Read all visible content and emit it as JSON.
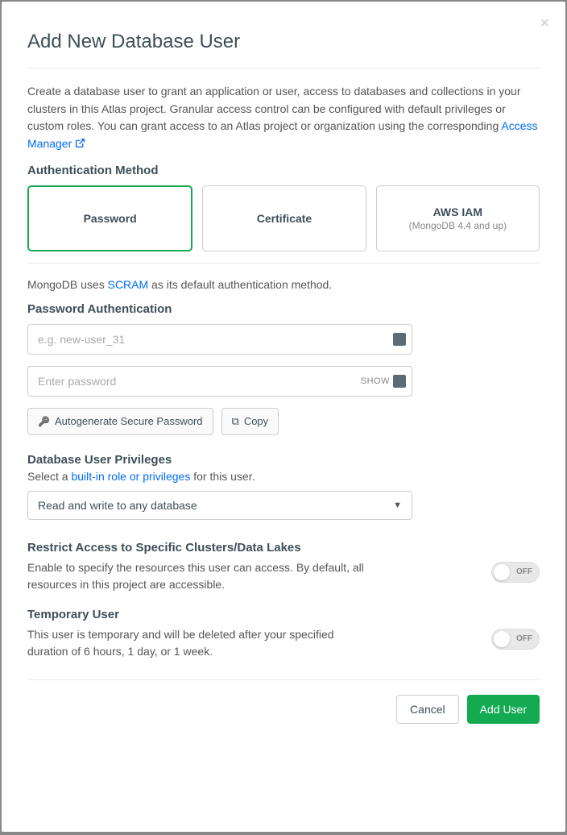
{
  "modal": {
    "title": "Add New Database User",
    "description_pre": "Create a database user to grant an application or user, access to databases and collections in your clusters in this Atlas project. Granular access control can be configured with default privileges or custom roles. You can grant access to an Atlas project or organization using the corresponding ",
    "access_manager_link": "Access Manager"
  },
  "auth": {
    "section_label": "Authentication Method",
    "methods": [
      {
        "label": "Password",
        "sub": ""
      },
      {
        "label": "Certificate",
        "sub": ""
      },
      {
        "label": "AWS IAM",
        "sub": "(MongoDB 4.4 and up)"
      }
    ],
    "selected_index": 0,
    "scram_note_pre": "MongoDB uses ",
    "scram_link": "SCRAM",
    "scram_note_post": " as its default authentication method."
  },
  "password_auth": {
    "section_label": "Password Authentication",
    "username_placeholder": "e.g. new-user_31",
    "username_value": "",
    "password_placeholder": "Enter password",
    "password_value": "",
    "show_label": "SHOW",
    "autogen_label": "Autogenerate Secure Password",
    "copy_label": "Copy"
  },
  "privileges": {
    "section_label": "Database User Privileges",
    "helper_pre": "Select a ",
    "helper_link": "built-in role or privileges",
    "helper_post": " for this user.",
    "selected": "Read and write to any database"
  },
  "restrict": {
    "section_label": "Restrict Access to Specific Clusters/Data Lakes",
    "description": "Enable to specify the resources this user can access. By default, all resources in this project are accessible.",
    "toggle_label": "OFF",
    "toggle_on": false
  },
  "temporary": {
    "section_label": "Temporary User",
    "description": "This user is temporary and will be deleted after your specified duration of 6 hours, 1 day, or 1 week.",
    "toggle_label": "OFF",
    "toggle_on": false
  },
  "footer": {
    "cancel": "Cancel",
    "submit": "Add User"
  }
}
